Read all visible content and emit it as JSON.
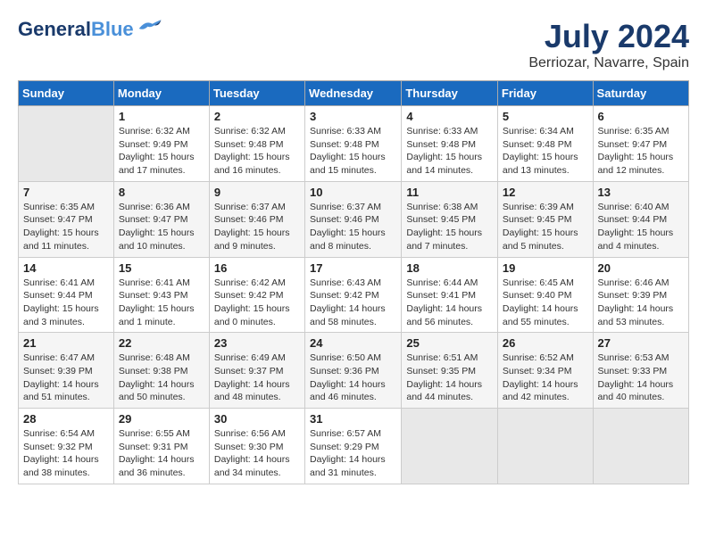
{
  "header": {
    "logo_line1": "General",
    "logo_line2": "Blue",
    "title": "July 2024",
    "subtitle": "Berriozar, Navarre, Spain"
  },
  "calendar": {
    "days_of_week": [
      "Sunday",
      "Monday",
      "Tuesday",
      "Wednesday",
      "Thursday",
      "Friday",
      "Saturday"
    ],
    "weeks": [
      [
        {
          "day": "",
          "info": ""
        },
        {
          "day": "1",
          "info": "Sunrise: 6:32 AM\nSunset: 9:49 PM\nDaylight: 15 hours\nand 17 minutes."
        },
        {
          "day": "2",
          "info": "Sunrise: 6:32 AM\nSunset: 9:48 PM\nDaylight: 15 hours\nand 16 minutes."
        },
        {
          "day": "3",
          "info": "Sunrise: 6:33 AM\nSunset: 9:48 PM\nDaylight: 15 hours\nand 15 minutes."
        },
        {
          "day": "4",
          "info": "Sunrise: 6:33 AM\nSunset: 9:48 PM\nDaylight: 15 hours\nand 14 minutes."
        },
        {
          "day": "5",
          "info": "Sunrise: 6:34 AM\nSunset: 9:48 PM\nDaylight: 15 hours\nand 13 minutes."
        },
        {
          "day": "6",
          "info": "Sunrise: 6:35 AM\nSunset: 9:47 PM\nDaylight: 15 hours\nand 12 minutes."
        }
      ],
      [
        {
          "day": "7",
          "info": "Sunrise: 6:35 AM\nSunset: 9:47 PM\nDaylight: 15 hours\nand 11 minutes."
        },
        {
          "day": "8",
          "info": "Sunrise: 6:36 AM\nSunset: 9:47 PM\nDaylight: 15 hours\nand 10 minutes."
        },
        {
          "day": "9",
          "info": "Sunrise: 6:37 AM\nSunset: 9:46 PM\nDaylight: 15 hours\nand 9 minutes."
        },
        {
          "day": "10",
          "info": "Sunrise: 6:37 AM\nSunset: 9:46 PM\nDaylight: 15 hours\nand 8 minutes."
        },
        {
          "day": "11",
          "info": "Sunrise: 6:38 AM\nSunset: 9:45 PM\nDaylight: 15 hours\nand 7 minutes."
        },
        {
          "day": "12",
          "info": "Sunrise: 6:39 AM\nSunset: 9:45 PM\nDaylight: 15 hours\nand 5 minutes."
        },
        {
          "day": "13",
          "info": "Sunrise: 6:40 AM\nSunset: 9:44 PM\nDaylight: 15 hours\nand 4 minutes."
        }
      ],
      [
        {
          "day": "14",
          "info": "Sunrise: 6:41 AM\nSunset: 9:44 PM\nDaylight: 15 hours\nand 3 minutes."
        },
        {
          "day": "15",
          "info": "Sunrise: 6:41 AM\nSunset: 9:43 PM\nDaylight: 15 hours\nand 1 minute."
        },
        {
          "day": "16",
          "info": "Sunrise: 6:42 AM\nSunset: 9:42 PM\nDaylight: 15 hours\nand 0 minutes."
        },
        {
          "day": "17",
          "info": "Sunrise: 6:43 AM\nSunset: 9:42 PM\nDaylight: 14 hours\nand 58 minutes."
        },
        {
          "day": "18",
          "info": "Sunrise: 6:44 AM\nSunset: 9:41 PM\nDaylight: 14 hours\nand 56 minutes."
        },
        {
          "day": "19",
          "info": "Sunrise: 6:45 AM\nSunset: 9:40 PM\nDaylight: 14 hours\nand 55 minutes."
        },
        {
          "day": "20",
          "info": "Sunrise: 6:46 AM\nSunset: 9:39 PM\nDaylight: 14 hours\nand 53 minutes."
        }
      ],
      [
        {
          "day": "21",
          "info": "Sunrise: 6:47 AM\nSunset: 9:39 PM\nDaylight: 14 hours\nand 51 minutes."
        },
        {
          "day": "22",
          "info": "Sunrise: 6:48 AM\nSunset: 9:38 PM\nDaylight: 14 hours\nand 50 minutes."
        },
        {
          "day": "23",
          "info": "Sunrise: 6:49 AM\nSunset: 9:37 PM\nDaylight: 14 hours\nand 48 minutes."
        },
        {
          "day": "24",
          "info": "Sunrise: 6:50 AM\nSunset: 9:36 PM\nDaylight: 14 hours\nand 46 minutes."
        },
        {
          "day": "25",
          "info": "Sunrise: 6:51 AM\nSunset: 9:35 PM\nDaylight: 14 hours\nand 44 minutes."
        },
        {
          "day": "26",
          "info": "Sunrise: 6:52 AM\nSunset: 9:34 PM\nDaylight: 14 hours\nand 42 minutes."
        },
        {
          "day": "27",
          "info": "Sunrise: 6:53 AM\nSunset: 9:33 PM\nDaylight: 14 hours\nand 40 minutes."
        }
      ],
      [
        {
          "day": "28",
          "info": "Sunrise: 6:54 AM\nSunset: 9:32 PM\nDaylight: 14 hours\nand 38 minutes."
        },
        {
          "day": "29",
          "info": "Sunrise: 6:55 AM\nSunset: 9:31 PM\nDaylight: 14 hours\nand 36 minutes."
        },
        {
          "day": "30",
          "info": "Sunrise: 6:56 AM\nSunset: 9:30 PM\nDaylight: 14 hours\nand 34 minutes."
        },
        {
          "day": "31",
          "info": "Sunrise: 6:57 AM\nSunset: 9:29 PM\nDaylight: 14 hours\nand 31 minutes."
        },
        {
          "day": "",
          "info": ""
        },
        {
          "day": "",
          "info": ""
        },
        {
          "day": "",
          "info": ""
        }
      ]
    ]
  }
}
